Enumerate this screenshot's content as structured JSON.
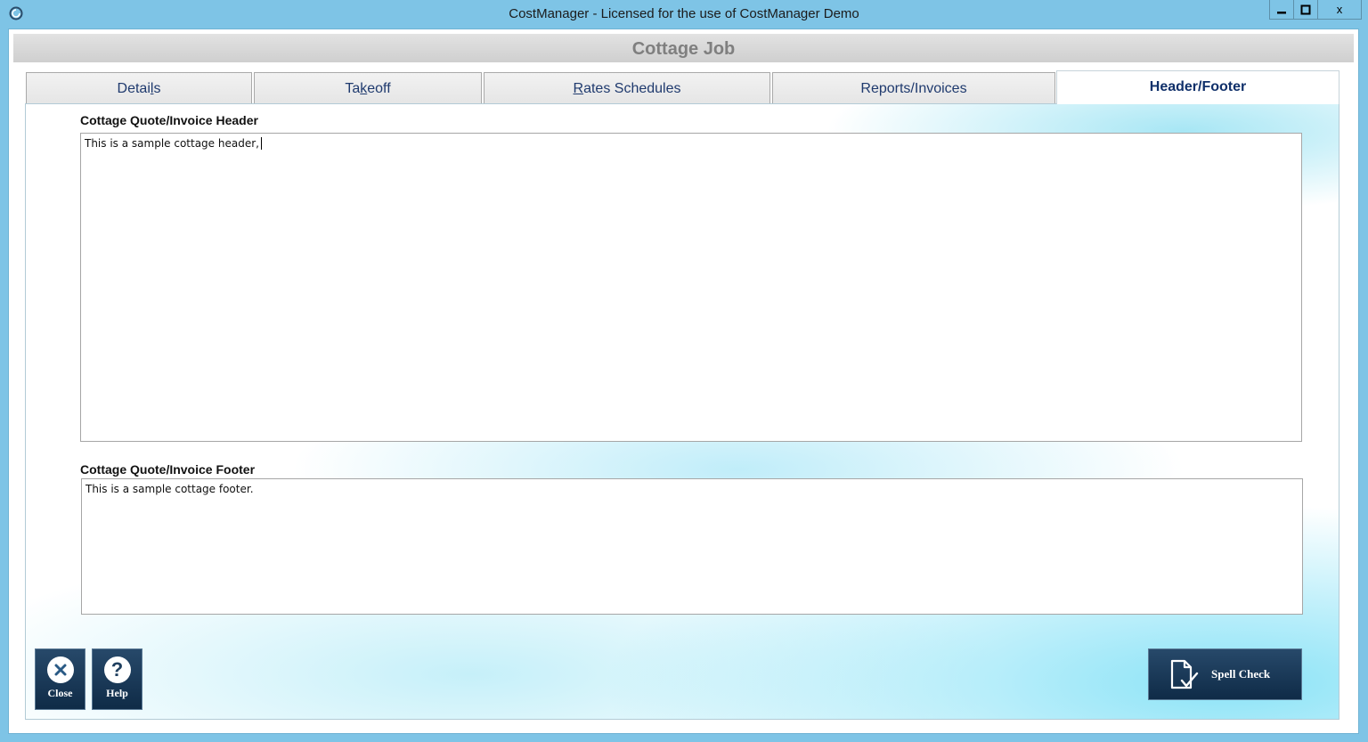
{
  "titlebar": {
    "title": "CostManager - Licensed for the use of CostManager Demo",
    "minimize": "‒",
    "maximize": "□",
    "close": "x"
  },
  "header": {
    "title": "Cottage Job"
  },
  "tabs": [
    {
      "pre": "Detai",
      "u": "l",
      "post": "s"
    },
    {
      "pre": "Ta",
      "u": "k",
      "post": "eoff"
    },
    {
      "pre": "",
      "u": "R",
      "post": "ates Schedules"
    },
    {
      "pre": "Reports/Invoices",
      "u": "",
      "post": ""
    },
    {
      "pre": "Header/Footer",
      "u": "",
      "post": ""
    }
  ],
  "active_tab": "Header/Footer",
  "header_section": {
    "label": "Cottage Quote/Invoice Header",
    "value": "This is a sample cottage header,"
  },
  "footer_section": {
    "label": "Cottage Quote/Invoice Footer",
    "value": "This is a sample cottage footer."
  },
  "buttons": {
    "close": "Close",
    "help": "Help",
    "spell_check": "Spell Check"
  },
  "colors": {
    "titlebar": "#7ec4e6",
    "button_dark": "#0f2b47",
    "tab_text": "#1f3a6e"
  }
}
